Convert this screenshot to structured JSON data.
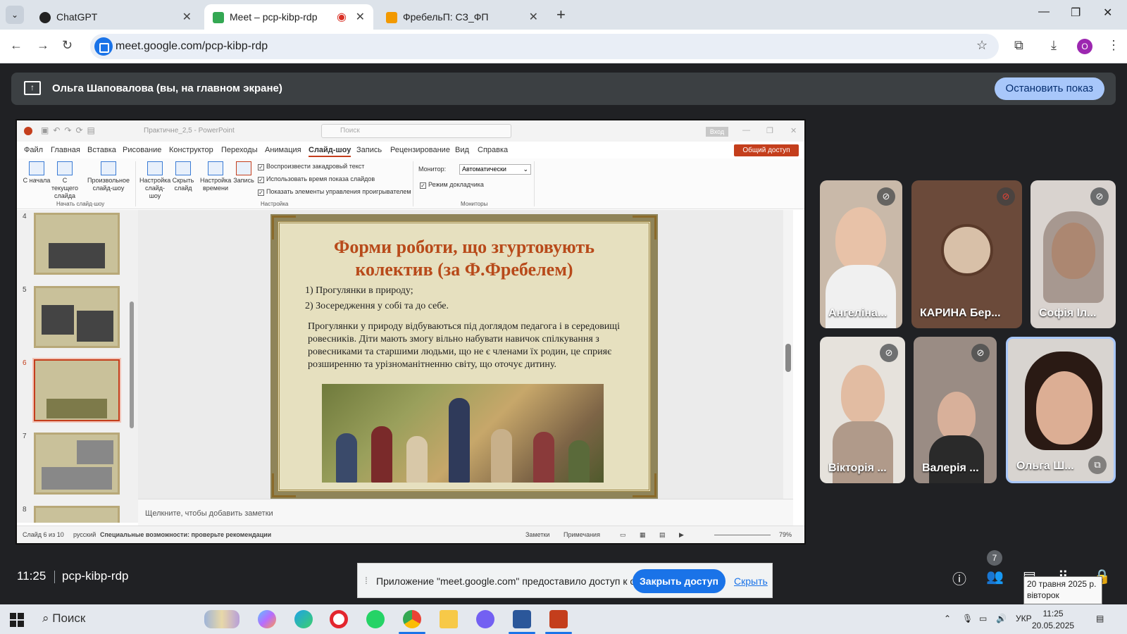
{
  "browser": {
    "tabs": [
      {
        "label": "ChatGPT",
        "active": false
      },
      {
        "label": "Meet – pcp-kibp-rdp",
        "active": true
      },
      {
        "label": "ФребельП: СЗ_ФП",
        "active": false
      }
    ],
    "url": "meet.google.com/pcp-kibp-rdp",
    "profile_initial": "O"
  },
  "presenting": {
    "text": "Ольга Шаповалова (вы, на главном экране)",
    "stop_label": "Остановить показ"
  },
  "powerpoint": {
    "filename": "Практичне_2,5  -  PowerPoint",
    "search_placeholder": "Поиск",
    "login_label": "Вход",
    "share_label": "Общий доступ",
    "menu": [
      "Файл",
      "Главная",
      "Вставка",
      "Рисование",
      "Конструктор",
      "Переходы",
      "Анимация",
      "Слайд-шоу",
      "Запись",
      "Рецензирование",
      "Вид",
      "Справка"
    ],
    "ribbon": {
      "from_start": "С начала",
      "from_current": "С текущего слайда",
      "custom_show": "Произвольное слайд-шоу",
      "group_start": "Начать слайд-шоу",
      "setup_show": "Настройка слайд-шоу",
      "hide_slide": "Скрыть слайд",
      "rehearse": "Настройка времени",
      "record": "Запись",
      "check_narration": "Воспроизвести закадровый текст",
      "check_timings": "Использовать время показа слайдов",
      "check_controls": "Показать элементы управления проигрывателем",
      "group_setup": "Настройка",
      "monitor_label": "Монитор:",
      "monitor_value": "Автоматически",
      "presenter_view": "Режим докладчика",
      "group_monitors": "Мониторы"
    },
    "thumb_numbers": [
      "4",
      "5",
      "6",
      "7",
      "8"
    ],
    "slide": {
      "title_line1": "Форми роботи, що згуртовують",
      "title_line2": "колектив (за Ф.Фребелем)",
      "item1": "1) Прогулянки в природу;",
      "item2": "2) Зосередження у собі та до себе.",
      "paragraph": "Прогулянки у природу відбуваються під доглядом педагога і в середовищі ровесників. Діти мають змогу вільно набувати навичок спілкування з ровесниками та старшими людьми, що не є членами їх родин, це сприяє розширенню та урізноманітненню світу, що оточує дитину."
    },
    "notes_placeholder": "Щелкните, чтобы добавить заметки",
    "status": {
      "slide_count": "Слайд 6 из 10",
      "language": "русский",
      "accessibility": "Специальные возможности: проверьте рекомендации",
      "notes": "Заметки",
      "comments": "Примечания",
      "zoom": "79%"
    }
  },
  "participants": [
    {
      "name": "Ангеліна...",
      "muted": true
    },
    {
      "name": "КАРИНА Бер...",
      "muted": true
    },
    {
      "name": "Софія Іл...",
      "muted": true
    },
    {
      "name": "Вікторія ...",
      "muted": true
    },
    {
      "name": "Валерія ...",
      "muted": true
    },
    {
      "name": "Ольга Ш...",
      "muted": false
    }
  ],
  "meet_bar": {
    "time": "11:25",
    "code": "pcp-kibp-rdp",
    "share_notice": "Приложение \"meet.google.com\" предоставило доступ к окну.",
    "close_access": "Закрыть доступ",
    "hide": "Скрыть",
    "people_count": "7",
    "tooltip_line1": "20 травня 2025 р.",
    "tooltip_line2": "вівторок"
  },
  "taskbar": {
    "search": "Поиск",
    "language": "УКР",
    "time": "11:25",
    "date": "20.05.2025"
  }
}
